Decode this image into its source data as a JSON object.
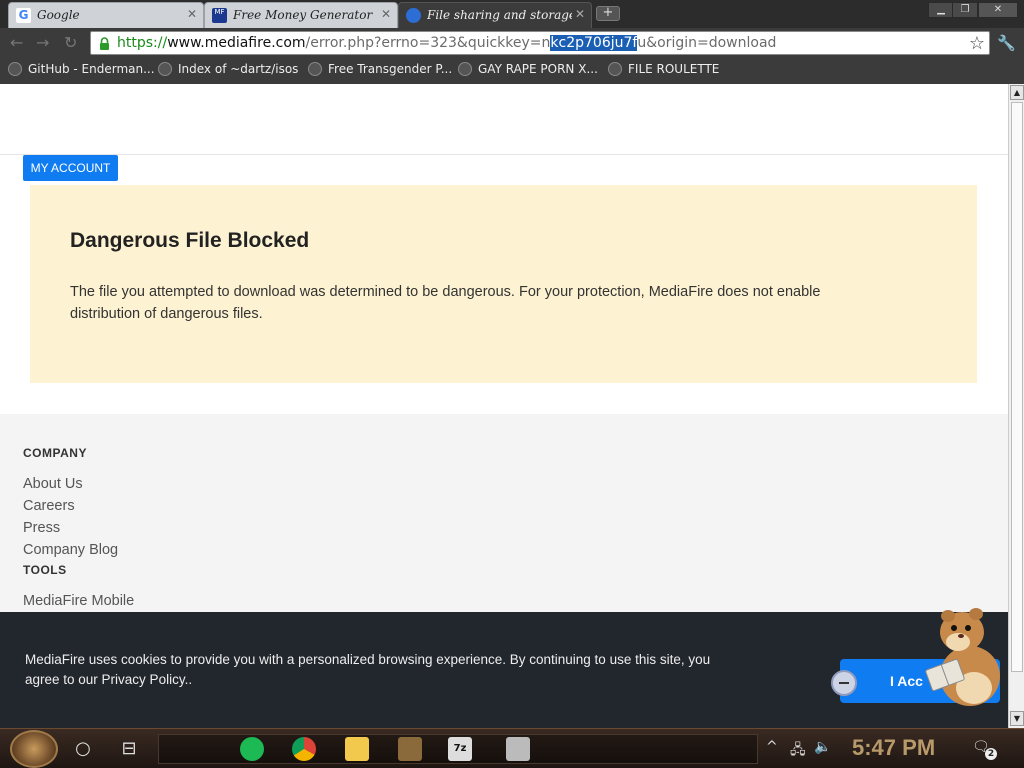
{
  "browser": {
    "tabs": [
      {
        "title": "Google",
        "active": false
      },
      {
        "title": "Free Money Generator",
        "active": false
      },
      {
        "title": "File sharing and storage m",
        "active": true
      }
    ],
    "url": {
      "protocol": "https://",
      "domain": "www.mediafire.com",
      "path_before": "/error.php?errno=323&quickkey=n",
      "selected": "kc2p706ju7f",
      "path_after": "u&origin=download"
    },
    "bookmarks": [
      "GitHub - Enderman...",
      "Index of ~dartz/isos",
      "Free Transgender P...",
      "GAY RAPE PORN X...",
      "FILE ROULETTE"
    ]
  },
  "page": {
    "my_account": "MY ACCOUNT",
    "alert": {
      "title": "Dangerous File Blocked",
      "body": "The file you attempted to download was determined to be dangerous. For your protection, MediaFire does not enable distribution of dangerous files."
    },
    "footer": {
      "company_heading": "COMPANY",
      "company_links": [
        "About Us",
        "Careers",
        "Press",
        "Company Blog"
      ],
      "tools_heading": "TOOLS",
      "tools_links": [
        "MediaFire Mobile"
      ]
    }
  },
  "cookie_banner": {
    "text": "MediaFire uses cookies to provide you with a personalized browsing experience. By continuing to use this site, you agree to our Privacy Policy..",
    "accept_label": "I Acc"
  },
  "taskbar": {
    "clock": "5:47 PM",
    "notification_count": "2"
  },
  "colors": {
    "accent_blue": "#0f7cf2",
    "alert_bg": "#fdf3d2",
    "cookie_bg": "#22262d"
  }
}
